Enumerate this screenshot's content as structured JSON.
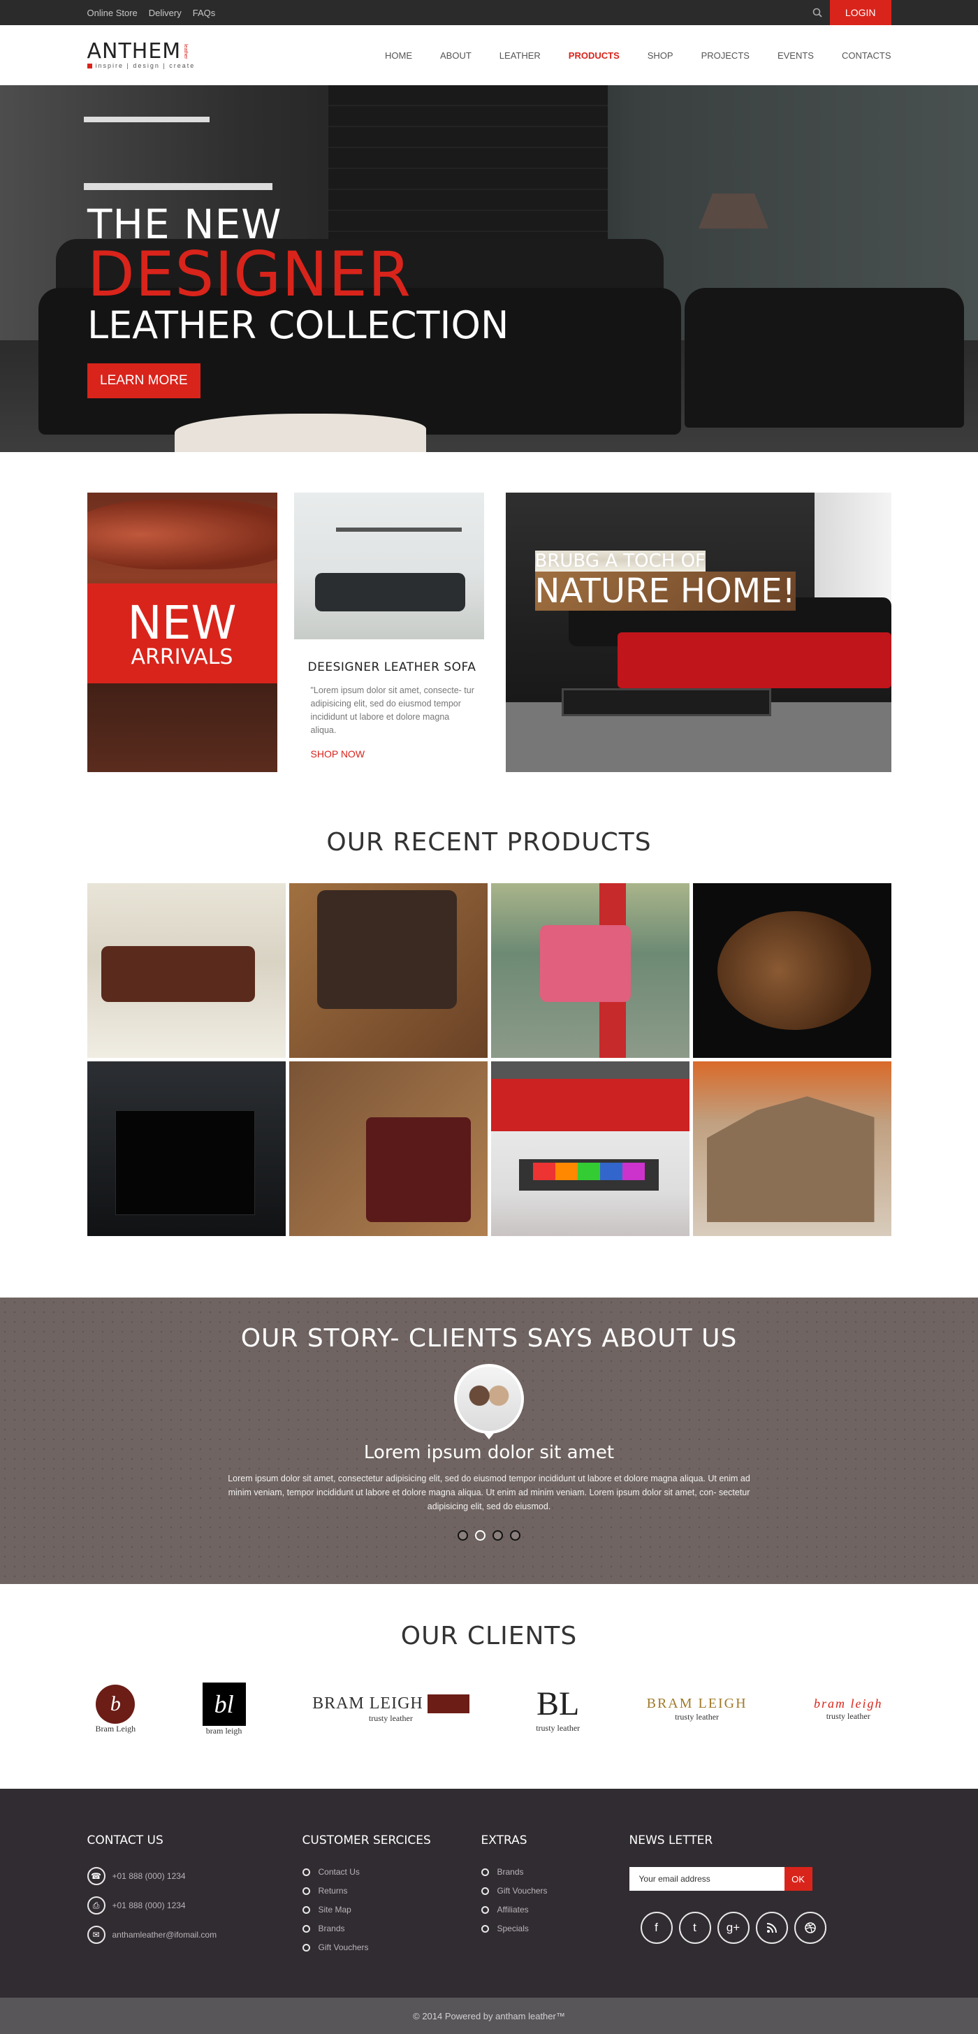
{
  "topbar": {
    "links": [
      "Online Store",
      "Delivery",
      "FAQs"
    ],
    "login": "LOGIN"
  },
  "header": {
    "logo": "ANTHEM",
    "logo_side": "leather",
    "tagline": "inspire | design | create",
    "nav": [
      "HOME",
      "ABOUT",
      "LEATHER",
      "PRODUCTS",
      "SHOP",
      "PROJECTS",
      "EVENTS",
      "CONTACTS"
    ],
    "active_nav": "PRODUCTS"
  },
  "hero": {
    "line1": "THE NEW",
    "line2": "DESIGNER",
    "line3": "LEATHER COLLECTION",
    "button": "LEARN MORE"
  },
  "features": {
    "new_line1": "NEW",
    "new_line2": "ARRIVALS",
    "sofa_title": "DEESIGNER  LEATHER SOFA",
    "sofa_text": "\"Lorem ipsum dolor sit amet, consecte- tur adipisicing elit, sed do eiusmod tempor incididunt ut labore et dolore magna aliqua.",
    "shop_link": "SHOP NOW",
    "nature_line1": "BRUBG A TOCH OF",
    "nature_line2": "NATURE HOME!"
  },
  "products": {
    "title": "OUR RECENT PRODUCTS"
  },
  "story": {
    "title": "OUR STORY- CLIENTS SAYS ABOUT US",
    "heading": "Lorem ipsum dolor sit amet",
    "text": "Lorem ipsum dolor sit amet, consectetur adipisicing elit, sed do eiusmod tempor incididunt ut labore et dolore magna aliqua. Ut enim ad minim veniam, tempor incididunt ut labore et dolore magna aliqua. Ut enim ad minim veniam. Lorem ipsum dolor sit amet, con- sectetur adipisicing elit, sed do eiusmod.",
    "slides": 4,
    "active_slide": 2
  },
  "clients": {
    "title": "OUR CLIENTS",
    "logo1": "Bram Leigh",
    "logo2_mark": "bl",
    "logo2_sub": "bram leigh",
    "logo3_mark": "BRAM LEIGH",
    "logo3_sub": "trusty leather",
    "logo4_mark": "BL",
    "logo4_sub": "trusty leather",
    "logo5_mark": "BRAM LEIGH",
    "logo5_sub": "trusty leather",
    "logo6_mark": "bram leigh",
    "logo6_sub": "trusty leather"
  },
  "footer": {
    "contact_title": "CONTACT US",
    "phone1": "+01 888 (000) 1234",
    "phone2": "+01 888 (000) 1234",
    "email": "anthamleather@ifomail.com",
    "services_title": "CUSTOMER SERCICES",
    "services": [
      "Contact Us",
      "Returns",
      "Site Map",
      "Brands",
      "Gift Vouchers"
    ],
    "extras_title": "EXTRAS",
    "extras": [
      "Brands",
      "Gift Vouchers",
      "Affiliates",
      "Specials"
    ],
    "news_title": "NEWS LETTER",
    "email_placeholder": "Your email address",
    "ok": "OK",
    "social": [
      "facebook-icon",
      "twitter-icon",
      "google-plus-icon",
      "rss-icon",
      "dribbble-icon"
    ],
    "copyright": "© 2014 Powered by antham leather™"
  },
  "colors": {
    "accent": "#d9241b",
    "dark": "#2b2b2b",
    "story_bg": "#6f6461",
    "footer_bg": "#312c31"
  }
}
